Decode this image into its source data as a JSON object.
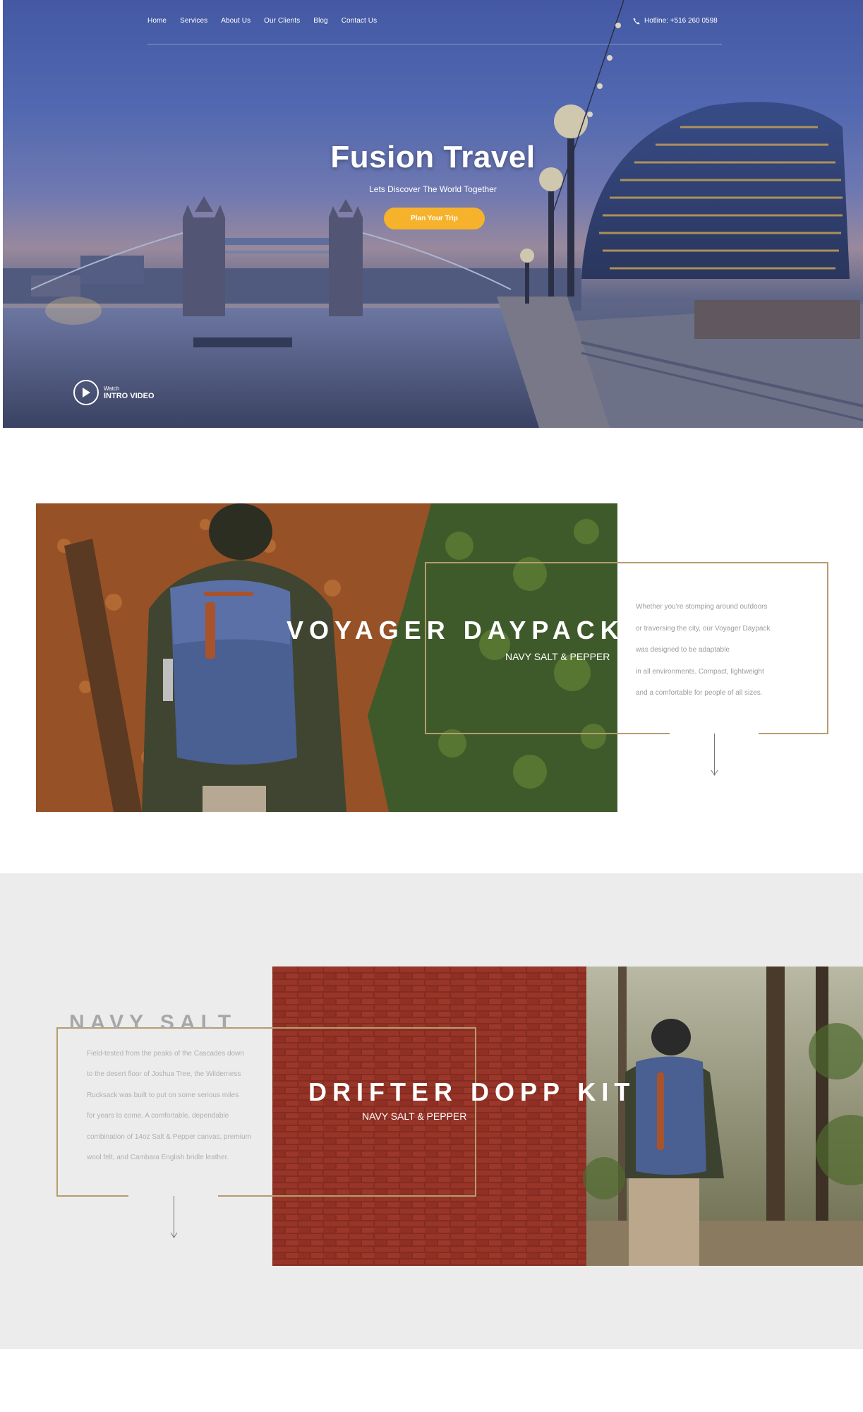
{
  "nav": {
    "items": [
      "Home",
      "Services",
      "About Us",
      "Our Clients",
      "Blog",
      "Contact Us"
    ],
    "hotline": "Hotline: +516 260 0598"
  },
  "hero": {
    "title": "Fusion Travel",
    "subtitle": "Lets Discover The World Together",
    "cta_label": "Plan Your Trip",
    "video_small": "Watch",
    "video_label": "INTRO VIDEO"
  },
  "product1": {
    "title": "VOYAGER DAYPACK",
    "subtitle": "NAVY SALT & PEPPER",
    "description": [
      "Whether you're stomping around outdoors",
      "or traversing the city, our Voyager Daypack",
      "was designed to be adaptable",
      "in all environments. Compact, lightweight",
      "and a comfortable for people of all sizes."
    ]
  },
  "product2": {
    "ghost_heading": "NAVY SALT",
    "title": "DRIFTER DOPP KIT",
    "subtitle": "NAVY SALT & PEPPER",
    "description": [
      "Field-tested from the peaks of the Cascades down",
      "to the desert floor of Joshua Tree, the Wilderness",
      "Rucksack was built to put on some serious miles",
      "for years to come. A comfortable, dependable",
      "combination of 14oz Salt & Pepper canvas, premium",
      "wool felt, and Cambara English bridle leather."
    ]
  },
  "colors": {
    "accent": "#f6b22a",
    "frame": "#b59d6e",
    "band": "#ececec"
  },
  "icons": [
    "phone-icon",
    "play-icon",
    "arrow-down-icon"
  ]
}
